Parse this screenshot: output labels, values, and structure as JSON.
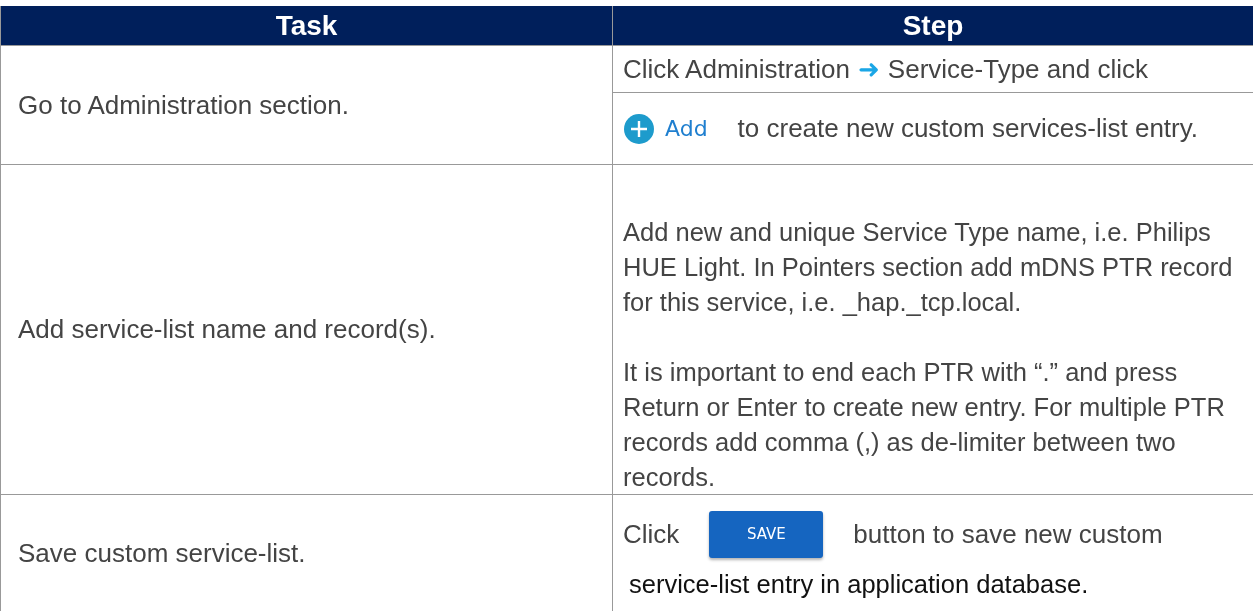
{
  "table": {
    "columns": [
      "Task",
      "Step"
    ],
    "rows": [
      {
        "task": "Go to Administration section.",
        "steps": [
          {
            "kind": "arrow_text",
            "before": "Click Administration",
            "arrow": "➜",
            "after": "Service-Type and click"
          },
          {
            "kind": "button_text",
            "button": {
              "kind": "add",
              "label": "Add"
            },
            "after": "to create new custom services-list entry."
          }
        ]
      },
      {
        "task": "Add service-list name and record(s).",
        "steps": [
          {
            "kind": "paragraph",
            "text": "Add new and unique Service Type name, i.e. Philips HUE Light. In Pointers section add mDNS PTR record for this service, i.e. _hap._tcp.local."
          },
          {
            "kind": "paragraph",
            "text": "It is important to end each PTR with “.” and press Return or Enter to create new entry. For multiple PTR records add comma (,) as de-limiter between two records."
          }
        ]
      },
      {
        "task": "Save custom service-list.",
        "steps": [
          {
            "kind": "button_text",
            "before": "Click",
            "button": {
              "kind": "save",
              "label": "SAVE"
            },
            "after": "button to save new custom"
          },
          {
            "kind": "paragraph",
            "text": "service-list entry in application database."
          }
        ]
      }
    ]
  }
}
